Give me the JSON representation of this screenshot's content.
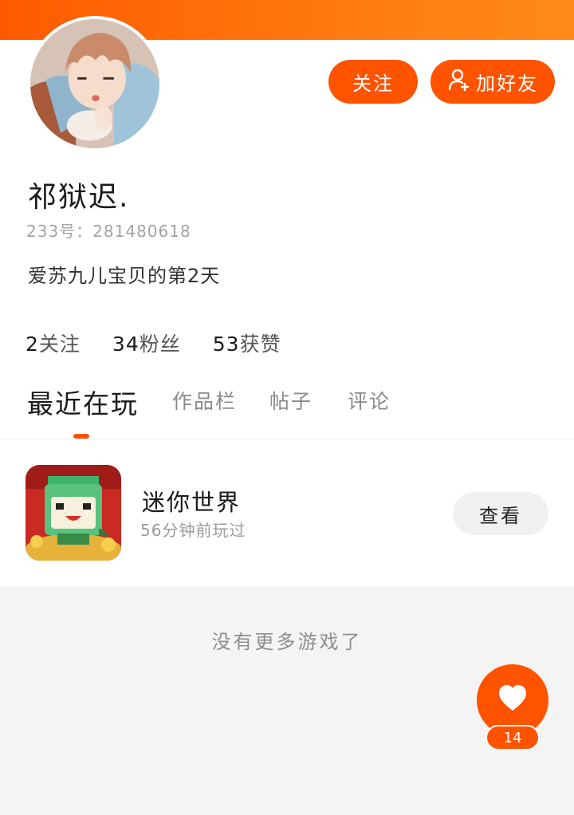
{
  "profile": {
    "username": "祁狱迟.",
    "uid_label": "233号：281480618",
    "bio": "爱苏九儿宝贝的第2天"
  },
  "actions": {
    "follow_label": "关注",
    "add_friend_label": "加好友"
  },
  "stats": {
    "following": {
      "value": "2",
      "label": "关注"
    },
    "fans": {
      "value": "34",
      "label": "粉丝"
    },
    "likes": {
      "value": "53",
      "label": "获赞"
    }
  },
  "tabs": [
    {
      "label": "最近在玩",
      "active": true
    },
    {
      "label": "作品栏",
      "active": false
    },
    {
      "label": "帖子",
      "active": false
    },
    {
      "label": "评论",
      "active": false
    }
  ],
  "recent_games": [
    {
      "name": "迷你世界",
      "last_played": "56分钟前玩过",
      "action_label": "查看",
      "icon": "mini-world-game-icon"
    }
  ],
  "empty_message": "没有更多游戏了",
  "like_fab": {
    "icon": "heart-icon",
    "count": "14"
  },
  "colors": {
    "accent": "#ff5300",
    "banner_gradient_start": "#ff5a00",
    "banner_gradient_end": "#ff8a1a"
  }
}
